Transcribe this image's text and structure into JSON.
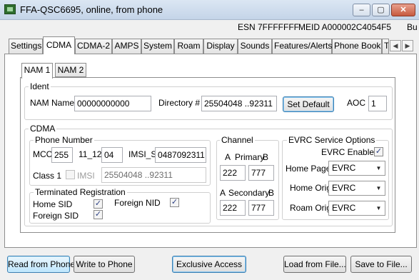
{
  "window": {
    "title": "FFA-QSC6695, online, from phone",
    "controls": [
      "–",
      "▢",
      "✕"
    ]
  },
  "info": {
    "esn": "ESN 7FFFFFFF",
    "meid": "MEID A000002C4054F5",
    "extra": "Bu"
  },
  "tabs": [
    "Settings",
    "CDMA",
    "CDMA-2",
    "AMPS",
    "System",
    "Roam",
    "Display",
    "Sounds",
    "Features/Alerts",
    "Phone Book",
    "T"
  ],
  "active_tab": "CDMA",
  "nam_tabs": [
    "NAM 1",
    "NAM 2"
  ],
  "ident": {
    "group_label": "Ident",
    "nam_name_label": "NAM Name",
    "nam_name_value": "00000000000",
    "directory_label": "Directory #",
    "directory_value": "25504048 ..92311",
    "set_default_label": "Set Default",
    "aoc_label": "AOC",
    "aoc_value": "1"
  },
  "cdma": {
    "group_label": "CDMA",
    "phone_number": {
      "group_label": "Phone Number",
      "mcc_label": "MCC",
      "mcc_value": "255",
      "imsi_11_12_label": "11_12",
      "imsi_11_12_value": "04",
      "imsi_s_label": "IMSI_S",
      "imsi_s_value": "0487092311",
      "class_label": "Class 1",
      "imsi_checkbox_label": "IMSI",
      "imsi_disabled_value": "25504048 ..92311"
    },
    "terminated_registration": {
      "group_label": "Terminated Registration",
      "home_sid_label": "Home SID",
      "foreign_nid_label": "Foreign NID",
      "foreign_sid_label": "Foreign SID",
      "home_sid_checked": true,
      "foreign_nid_checked": true,
      "foreign_sid_checked": true
    },
    "channel": {
      "group_label": "Channel",
      "primary_label": "Primary",
      "secondary_label": "Secondary",
      "a_label": "A",
      "b_label": "B",
      "primary_a": "222",
      "primary_b": "777",
      "secondary_a": "222",
      "secondary_b": "777"
    },
    "evrc": {
      "group_label": "EVRC Service Options",
      "enabled_label": "EVRC Enabled",
      "enabled_checked": true,
      "home_page_label": "Home Page",
      "home_page_value": "EVRC",
      "home_orig_label": "Home Orig",
      "home_orig_value": "EVRC",
      "roam_orig_label": "Roam Orig",
      "roam_orig_value": "EVRC"
    }
  },
  "bottom_buttons": {
    "read": "Read from Phone",
    "write": "Write to Phone",
    "exclusive": "Exclusive Access",
    "load": "Load from File...",
    "save": "Save to File..."
  },
  "check_glyph": "✓"
}
